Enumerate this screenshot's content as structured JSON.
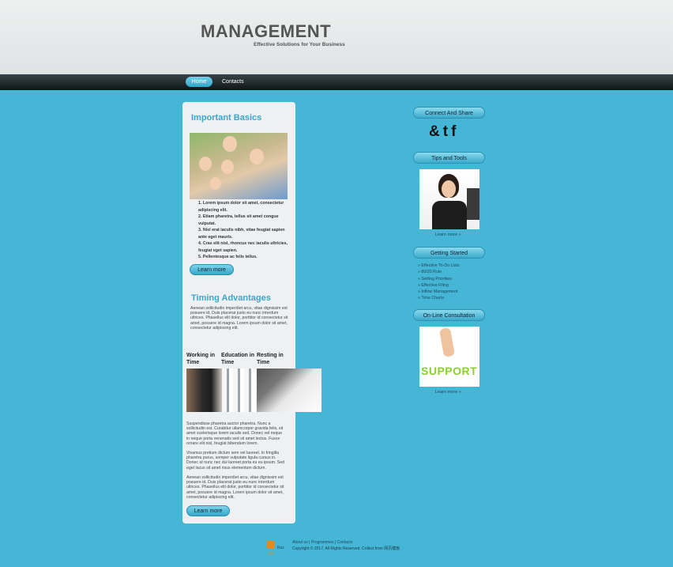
{
  "header": {
    "title": "MANAGEMENT",
    "subtitle": "Effective Solutions for Your Business"
  },
  "nav": {
    "items": [
      "Home",
      "Contacts"
    ]
  },
  "main": {
    "section1": {
      "title": "Important Basics",
      "list": [
        "1. Lorem ipsum dolor sit amet, consectetur adipiscing elit.",
        "2. Etiam pharetra, tellus sit amet congue vulputat.",
        "3. Nisl erat iaculis nibh, vitae feugiat sapien ante eget mauris.",
        "4. Cras elit nisl, rhoncus nec iaculis ultricies, feugiat eget sapien.",
        "5. Pellentesque ac felis tellus."
      ],
      "button": "Learn more"
    },
    "section2": {
      "title": "Timing Advantages",
      "intro": "Aenean sollicitudin imperdiet arcu, vitae dignissim est posuere id. Duis placerat justo eu nunc interdum ultrices. Phasellus elit dolor, porttitor id consectetur sit amet, posuere id magna. Lorem ipsum dolor sit amet, consectetur adipiscing elit.",
      "columns": [
        "Working in Time",
        "Education in Time",
        "Resting in Time"
      ],
      "para1": "Suspendisse pharetra auctor pharetra. Nunc a sollicitudin est. Curabitur ullamcorper gravida felis, sit amet scelerisque lorem iaculis sed. Donec vel neque in neque porta venenatis sed sit amet lectus. Fusce ornare elit nisl, feugiat bibendum lorem.",
      "para2": "Vivamus pretium dictum sem vel laoreet. In fringilla pharetra purus, semper vulputate ligula cursus in. Donec at nunc nec dui laoreet porta eu eu ipsum. Sed eget lacus sit amet risus elementum dictum.",
      "para3": "Aenean sollicitudin imperdiet arcu, vitae dignissim est posuere id. Duis placerat justo eu nunc interdum ultrices. Phasellus elit dolor, porttitor id consectetur sit amet, posuere id magna. Lorem ipsum dolor sit amet, consectetur adipiscing elit.",
      "button": "Learn more"
    }
  },
  "sidebar": {
    "connect": "Connect And Share",
    "social": [
      "&",
      "t",
      "f"
    ],
    "tips": "Tips and Tools",
    "learn_more_1": "Learn more »",
    "getting_started": "Getting Started",
    "links": [
      "Effective To-Do Lists",
      "80/20 Rule",
      "Setting Priorities",
      "Effective Filing",
      "Inflow Management",
      "Time Charts"
    ],
    "online": "On-Line Consultation",
    "support_text": "SUPPORT",
    "learn_more_2": "Learn more »"
  },
  "footer": {
    "links": "About us | Programmes | Contacts",
    "copyright": "Copyright © 2017. All Rights Reserved. Collect from 网页模板",
    "rss": "Rss",
    "rss_sub": "订阅"
  }
}
